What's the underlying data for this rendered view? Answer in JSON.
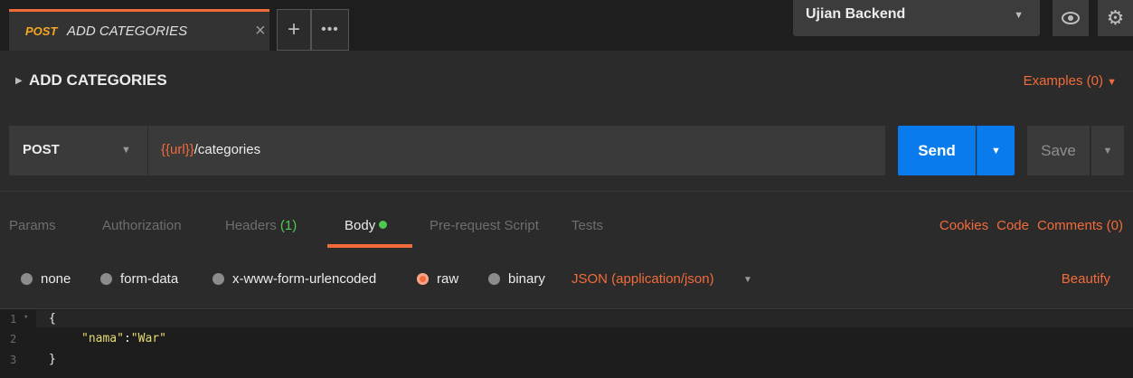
{
  "tab": {
    "method": "POST",
    "title": "ADD CATEGORIES"
  },
  "environment": {
    "name": "Ujian Backend"
  },
  "request": {
    "name": "ADD CATEGORIES",
    "examples_label": "Examples (0)"
  },
  "urlbar": {
    "method": "POST",
    "url_var": "{{url}}",
    "url_path": "/categories",
    "send_label": "Send",
    "save_label": "Save"
  },
  "request_tabs": [
    {
      "label": "Params"
    },
    {
      "label": "Authorization"
    },
    {
      "label": "Headers",
      "count": "(1)"
    },
    {
      "label": "Body"
    },
    {
      "label": "Pre-request Script"
    },
    {
      "label": "Tests"
    }
  ],
  "right_links": {
    "cookies": "Cookies",
    "code": "Code",
    "comments": "Comments (0)"
  },
  "body_options": [
    {
      "label": "none"
    },
    {
      "label": "form-data"
    },
    {
      "label": "x-www-form-urlencoded"
    },
    {
      "label": "raw"
    },
    {
      "label": "binary"
    }
  ],
  "body_format": "JSON (application/json)",
  "beautify_label": "Beautify",
  "editor": {
    "line_numbers": [
      "1",
      "2",
      "3"
    ],
    "lines": {
      "l1": "{",
      "l2_key": "\"nama\"",
      "l2_colon": ":",
      "l2_value": "\"War\"",
      "l3": "}"
    }
  },
  "colors": {
    "accent": "#f26b3a",
    "send_blue": "#097bed",
    "status_green": "#4ec94e"
  },
  "icons": {
    "close": "close-icon",
    "add": "plus-icon",
    "more": "ellipsis-icon",
    "eye": "eye-icon",
    "settings": "gear-icon"
  }
}
